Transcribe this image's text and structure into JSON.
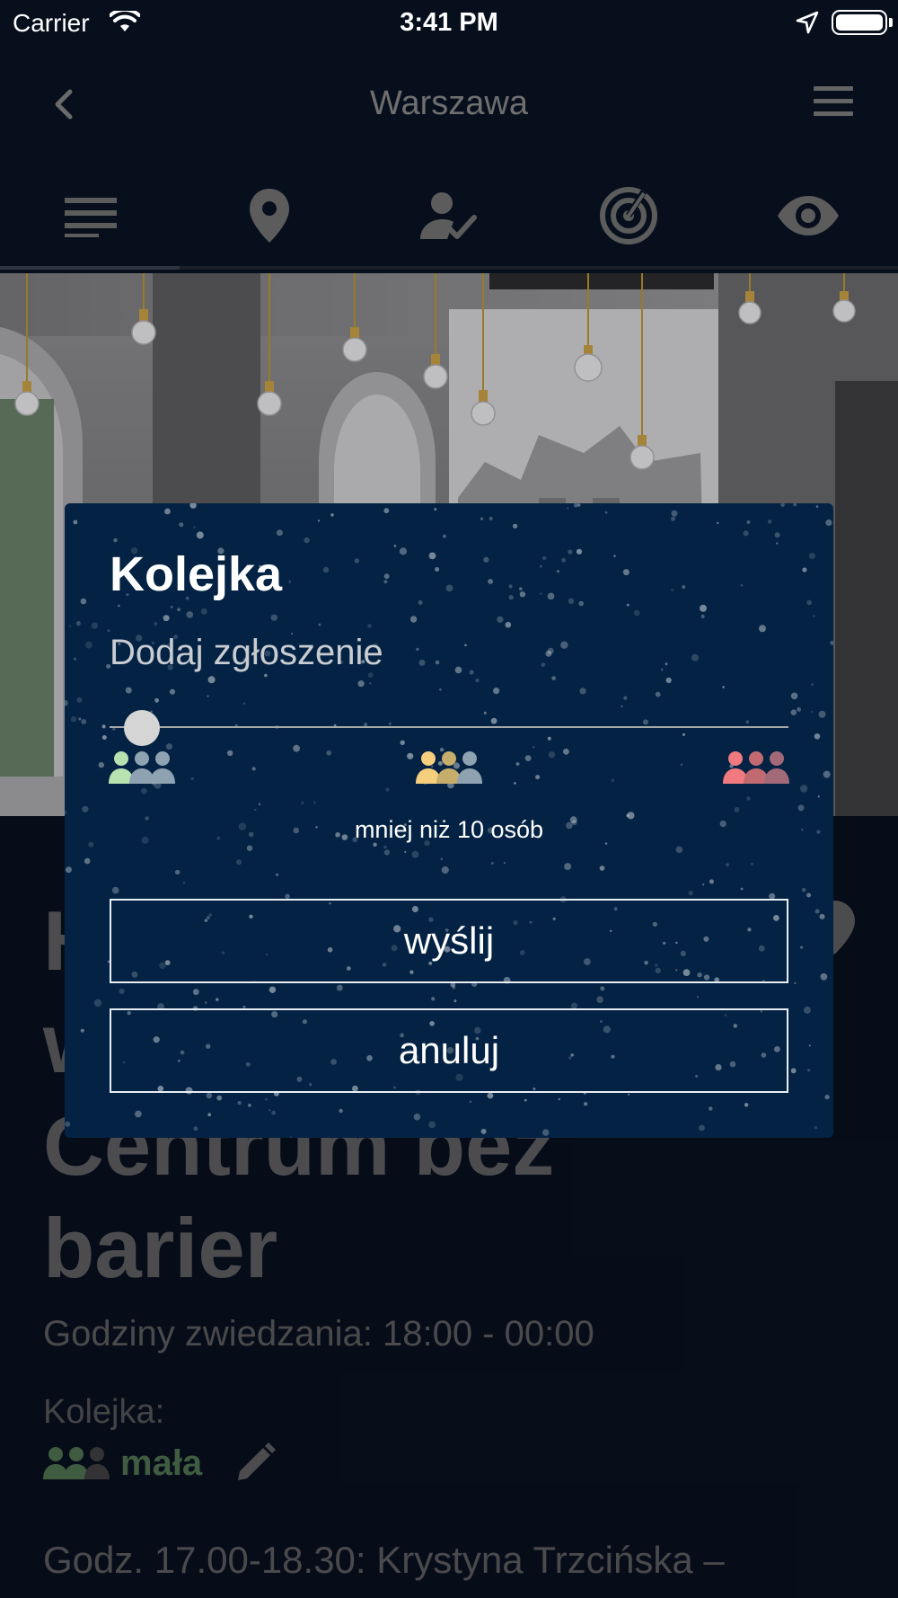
{
  "status_bar": {
    "carrier": "Carrier",
    "time": "3:41 PM"
  },
  "nav": {
    "title": "Warszawa",
    "back_icon": "chevron-left-icon",
    "menu_icon": "hamburger-menu-icon"
  },
  "tabs": [
    {
      "icon": "list-icon",
      "active": true
    },
    {
      "icon": "map-pin-icon",
      "active": false
    },
    {
      "icon": "person-check-icon",
      "active": false
    },
    {
      "icon": "radar-icon",
      "active": false
    },
    {
      "icon": "eye-icon",
      "active": false
    }
  ],
  "content": {
    "title_lines": [
      "H",
      "w",
      "Centrum bez",
      "barier"
    ],
    "hours": "Godziny zwiedzania: 18:00 - 00:00",
    "queue_label": "Kolejka:",
    "queue_status": "mała",
    "description": "Godz. 17.00-18.30: Krystyna Trzcińska –"
  },
  "dialog": {
    "title": "Kolejka",
    "subtitle": "Dodaj zgłoszenie",
    "queue_levels": [
      {
        "icon": "people-small-icon",
        "color": "#b8e2b0"
      },
      {
        "icon": "people-medium-icon",
        "color": "#f5cf7e"
      },
      {
        "icon": "people-large-icon",
        "color": "#f07a80"
      }
    ],
    "selected_level": 0,
    "selected_caption": "mniej niż 10 osób",
    "send_label": "wyślij",
    "cancel_label": "anuluj"
  },
  "colors": {
    "background": "#070f1c",
    "dialog_bg": "#042344",
    "queue_small_status": "#4c6f4c"
  }
}
